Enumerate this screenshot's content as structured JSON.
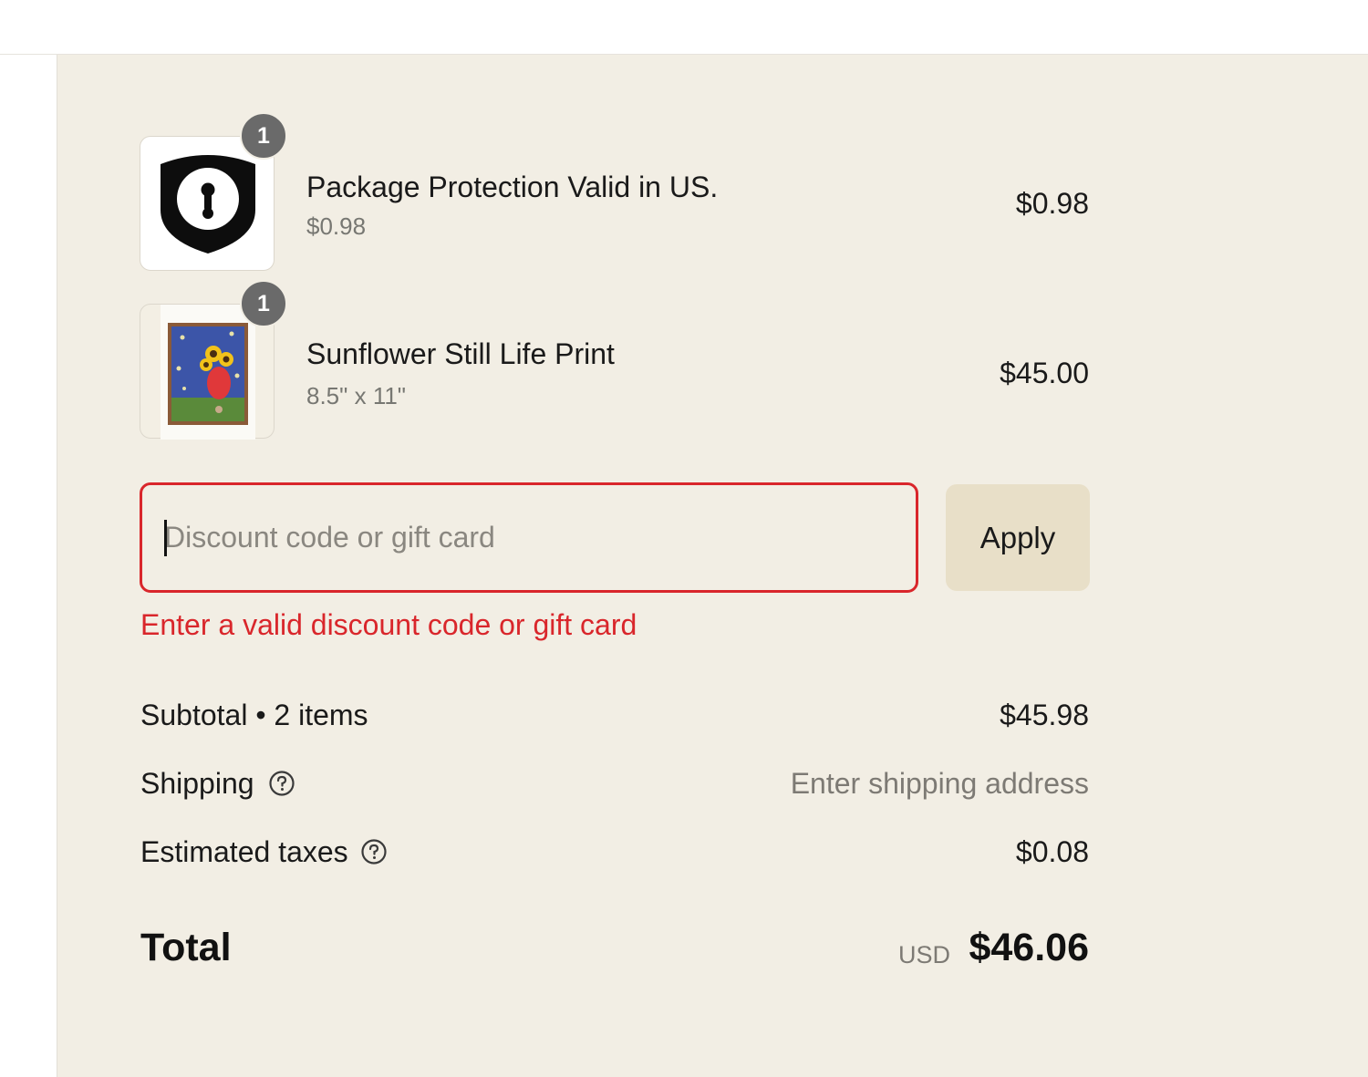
{
  "colors": {
    "summary_bg": "#f2eee4",
    "error_red": "#d9262b",
    "apply_bg": "#e8dfc8",
    "badge_gray": "#6a6a6a"
  },
  "line_items": [
    {
      "icon": "shield-lock-icon",
      "quantity": "1",
      "title": "Package Protection Valid in US.",
      "subtitle": "$0.98",
      "price": "$0.98"
    },
    {
      "icon": "sunflower-print-thumbnail",
      "quantity": "1",
      "title": "Sunflower Still Life Print",
      "subtitle": "8.5\" x 11\"",
      "price": "$45.00"
    }
  ],
  "discount": {
    "placeholder": "Discount code or gift card",
    "value": "",
    "apply_label": "Apply",
    "error": "Enter a valid discount code or gift card"
  },
  "totals": {
    "subtotal_label": "Subtotal • 2 items",
    "subtotal_value": "$45.98",
    "shipping_label": "Shipping",
    "shipping_value": "Enter shipping address",
    "taxes_label": "Estimated taxes",
    "taxes_value": "$0.08",
    "total_label": "Total",
    "currency": "USD",
    "total_value": "$46.06"
  }
}
